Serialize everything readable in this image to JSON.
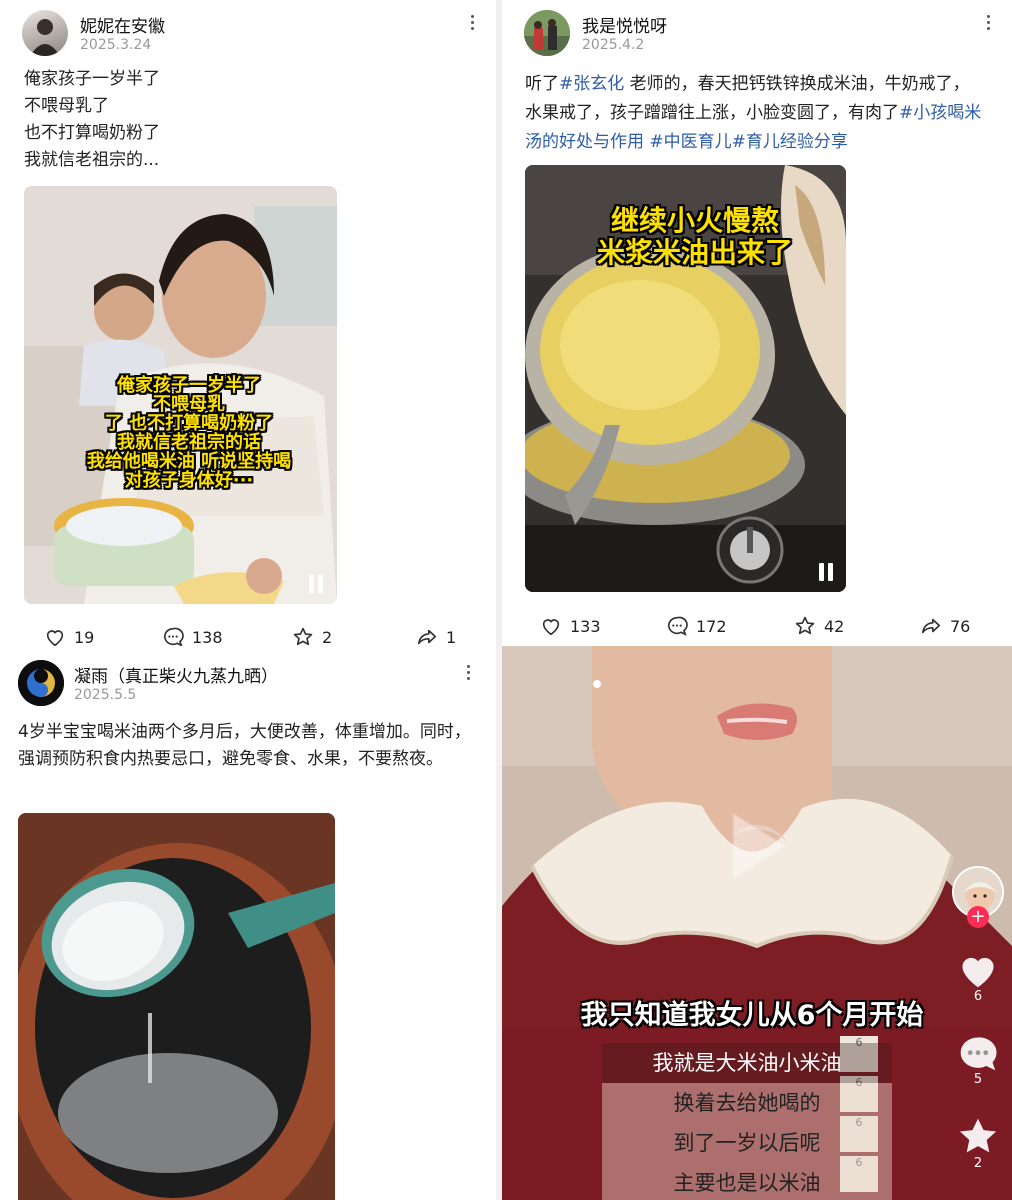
{
  "posts": [
    {
      "author": "妮妮在安徽",
      "date": "2025.3.24",
      "lines": [
        "俺家孩子一岁半了",
        "不喂母乳了",
        "也不打算喝奶粉了",
        "我就信老祖宗的..."
      ],
      "video_caption": [
        "俺家孩子一岁半了",
        "不喂母乳",
        "了 也不打算喝奶粉了",
        "我就信老祖宗的话",
        "我给他喝米油 听说坚持喝",
        "对孩子身体好···"
      ],
      "likes": "19",
      "comments": "138",
      "favorites": "2",
      "shares": "1"
    },
    {
      "author": "我是悦悦呀",
      "date": "2025.4.2",
      "text_plain_1": "听了",
      "tag_1": "#张玄化",
      "text_plain_2": " 老师的，春天把钙铁锌换成米油，牛奶戒了，水果戒了，孩子蹭蹭往上涨，小脸变圆了，有肉了",
      "tag_2": "#小孩喝米汤的好处与作用",
      "tag_3": " #中医育儿",
      "tag_4": "#育儿经验分享",
      "video_caption": [
        "继续小火慢熬",
        "米浆米油出来了"
      ],
      "likes": "133",
      "comments": "172",
      "favorites": "42",
      "shares": "76"
    },
    {
      "author": "凝雨（真正柴火九蒸九晒）",
      "date": "2025.5.5",
      "text": "4岁半宝宝喝米油两个多月后，大便改善，体重增加。同时，强调预防积食内热要忌口，避免零食、水果，不要熬夜。"
    },
    {
      "video_caption": [
        "我只知道我女儿从6个月开始",
        "我就是大米油小米油",
        "换着去给她喝的",
        "到了一岁以后呢",
        "主要也是以米油"
      ],
      "likes": "6",
      "comments": "5",
      "favorites": "2",
      "strip_labels": [
        "6",
        "6",
        "6",
        "6"
      ]
    }
  ],
  "colors": {
    "hashtag": "#2f5da8",
    "caption_yellow": "#ffe100",
    "follow_red": "#fe2c55"
  },
  "icons": [
    "more-vertical-icon",
    "heart-icon",
    "comment-icon",
    "star-icon",
    "share-icon",
    "pause-icon",
    "play-icon",
    "plus-icon"
  ]
}
